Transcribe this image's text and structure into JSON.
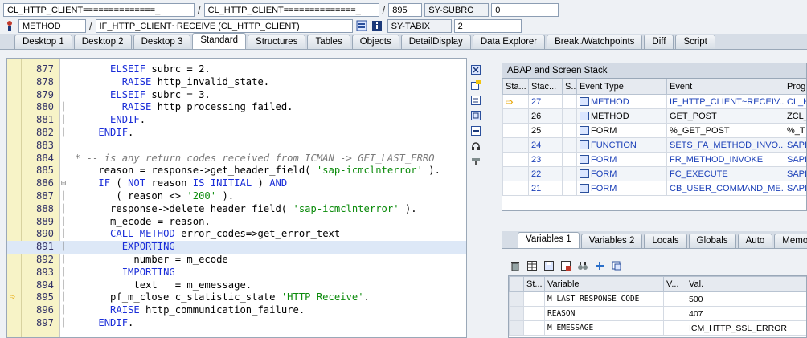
{
  "topbar": {
    "row1": {
      "program1": "CL_HTTP_CLIENT==============_",
      "program2": "CL_HTTP_CLIENT==============_",
      "line": "895",
      "sysfield_name": "SY-SUBRC",
      "sysfield_value": "0"
    },
    "row2": {
      "event_type": "METHOD",
      "event": "IF_HTTP_CLIENT~RECEIVE (CL_HTTP_CLIENT)",
      "sysfield_name": "SY-TABIX",
      "sysfield_value": "2"
    }
  },
  "tabs": [
    {
      "label": "Desktop 1",
      "active": false
    },
    {
      "label": "Desktop 2",
      "active": false
    },
    {
      "label": "Desktop 3",
      "active": false
    },
    {
      "label": "Standard",
      "active": true
    },
    {
      "label": "Structures",
      "active": false
    },
    {
      "label": "Tables",
      "active": false
    },
    {
      "label": "Objects",
      "active": false
    },
    {
      "label": "DetailDisplay",
      "active": false
    },
    {
      "label": "Data Explorer",
      "active": false
    },
    {
      "label": "Break./Watchpoints",
      "active": false
    },
    {
      "label": "Diff",
      "active": false
    },
    {
      "label": "Script",
      "active": false
    }
  ],
  "code": [
    {
      "n": "877",
      "t": "      ELSEIF subrc = 2."
    },
    {
      "n": "878",
      "t": "        RAISE http_invalid_state."
    },
    {
      "n": "879",
      "t": "      ELSEIF subrc = 3."
    },
    {
      "n": "880",
      "t": "        RAISE http_processing_failed."
    },
    {
      "n": "881",
      "t": "      ENDIF."
    },
    {
      "n": "882",
      "t": "    ENDIF."
    },
    {
      "n": "883",
      "t": ""
    },
    {
      "n": "884",
      "t": "* -- is any return codes received from ICMAN -> GET_LAST_ERRO"
    },
    {
      "n": "885",
      "t": "    reason = response->get_header_field( 'sap-icmclnterror' )."
    },
    {
      "n": "886",
      "t": "    IF ( NOT reason IS INITIAL ) AND"
    },
    {
      "n": "887",
      "t": "       ( reason <> '200' )."
    },
    {
      "n": "888",
      "t": "      response->delete_header_field( 'sap-icmclnterror' )."
    },
    {
      "n": "889",
      "t": "      m_ecode = reason."
    },
    {
      "n": "890",
      "t": "      CALL METHOD error_codes=>get_error_text"
    },
    {
      "n": "891",
      "t": "        EXPORTING"
    },
    {
      "n": "892",
      "t": "          number = m_ecode"
    },
    {
      "n": "893",
      "t": "        IMPORTING"
    },
    {
      "n": "894",
      "t": "          text   = m_emessage."
    },
    {
      "n": "895",
      "t": "      pf_m_close c_statistic_state 'HTTP Receive'."
    },
    {
      "n": "896",
      "t": "      RAISE http_communication_failure."
    },
    {
      "n": "897",
      "t": "    ENDIF."
    }
  ],
  "stack": {
    "title": "ABAP and Screen Stack",
    "headers": [
      "Sta...",
      "Stac...",
      "S...",
      "Event Type",
      "Event",
      "Progr"
    ],
    "rows": [
      {
        "level": "27",
        "type": "METHOD",
        "event": "IF_HTTP_CLIENT~RECEIV...",
        "prog": "CL_H",
        "link": true,
        "current": true
      },
      {
        "level": "26",
        "type": "METHOD",
        "event": "GET_POST",
        "prog": "ZCL_",
        "link": false,
        "current": false
      },
      {
        "level": "25",
        "type": "FORM",
        "event": "%_GET_POST",
        "prog": "%_T",
        "link": false,
        "current": false
      },
      {
        "level": "24",
        "type": "FUNCTION",
        "event": "SETS_FA_METHOD_INVO...",
        "prog": "SAPL",
        "link": true,
        "current": false
      },
      {
        "level": "23",
        "type": "FORM",
        "event": "FR_METHOD_INVOKE",
        "prog": "SAPL",
        "link": true,
        "current": false
      },
      {
        "level": "22",
        "type": "FORM",
        "event": "FC_EXECUTE",
        "prog": "SAPL",
        "link": true,
        "current": false
      },
      {
        "level": "21",
        "type": "FORM",
        "event": "CB_USER_COMMAND_ME...",
        "prog": "SAPL",
        "link": true,
        "current": false
      }
    ]
  },
  "vars_tabs": [
    {
      "label": "Variables 1",
      "active": true
    },
    {
      "label": "Variables 2",
      "active": false
    },
    {
      "label": "Locals",
      "active": false
    },
    {
      "label": "Globals",
      "active": false
    },
    {
      "label": "Auto",
      "active": false
    },
    {
      "label": "Memory",
      "active": false
    }
  ],
  "vars": {
    "headers": [
      "St...",
      "Variable",
      "V...",
      "Val."
    ],
    "rows": [
      {
        "var": "M_LAST_RESPONSE_CODE",
        "val": "500"
      },
      {
        "var": "REASON",
        "val": "407"
      },
      {
        "var": "M_EMESSAGE",
        "val": "ICM_HTTP_SSL_ERROR"
      }
    ]
  }
}
